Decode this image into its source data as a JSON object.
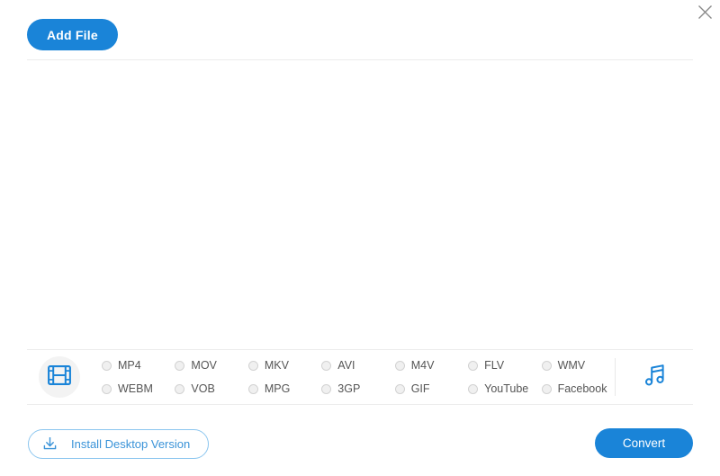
{
  "window": {
    "close_label": "×",
    "close_icon": "close-icon"
  },
  "toolbar": {
    "add_file_label": "Add File",
    "add_file_color": "#1a84d8"
  },
  "file_area": {
    "items": [],
    "empty_text": ""
  },
  "format_panel": {
    "video_icon": "film-strip-icon",
    "audio_icon": "music-note-icon",
    "icon_color": "#1a84d8",
    "selected": null,
    "formats": [
      {
        "label": "MP4",
        "selected": false
      },
      {
        "label": "MOV",
        "selected": false
      },
      {
        "label": "MKV",
        "selected": false
      },
      {
        "label": "AVI",
        "selected": false
      },
      {
        "label": "M4V",
        "selected": false
      },
      {
        "label": "FLV",
        "selected": false
      },
      {
        "label": "WMV",
        "selected": false
      },
      {
        "label": "WEBM",
        "selected": false
      },
      {
        "label": "VOB",
        "selected": false
      },
      {
        "label": "MPG",
        "selected": false
      },
      {
        "label": "3GP",
        "selected": false
      },
      {
        "label": "GIF",
        "selected": false
      },
      {
        "label": "YouTube",
        "selected": false
      },
      {
        "label": "Facebook",
        "selected": false
      }
    ]
  },
  "footer": {
    "install_label": "Install Desktop Version",
    "install_icon": "download-icon",
    "install_color": "#3a93d8",
    "convert_label": "Convert",
    "convert_color": "#1a84d8"
  }
}
